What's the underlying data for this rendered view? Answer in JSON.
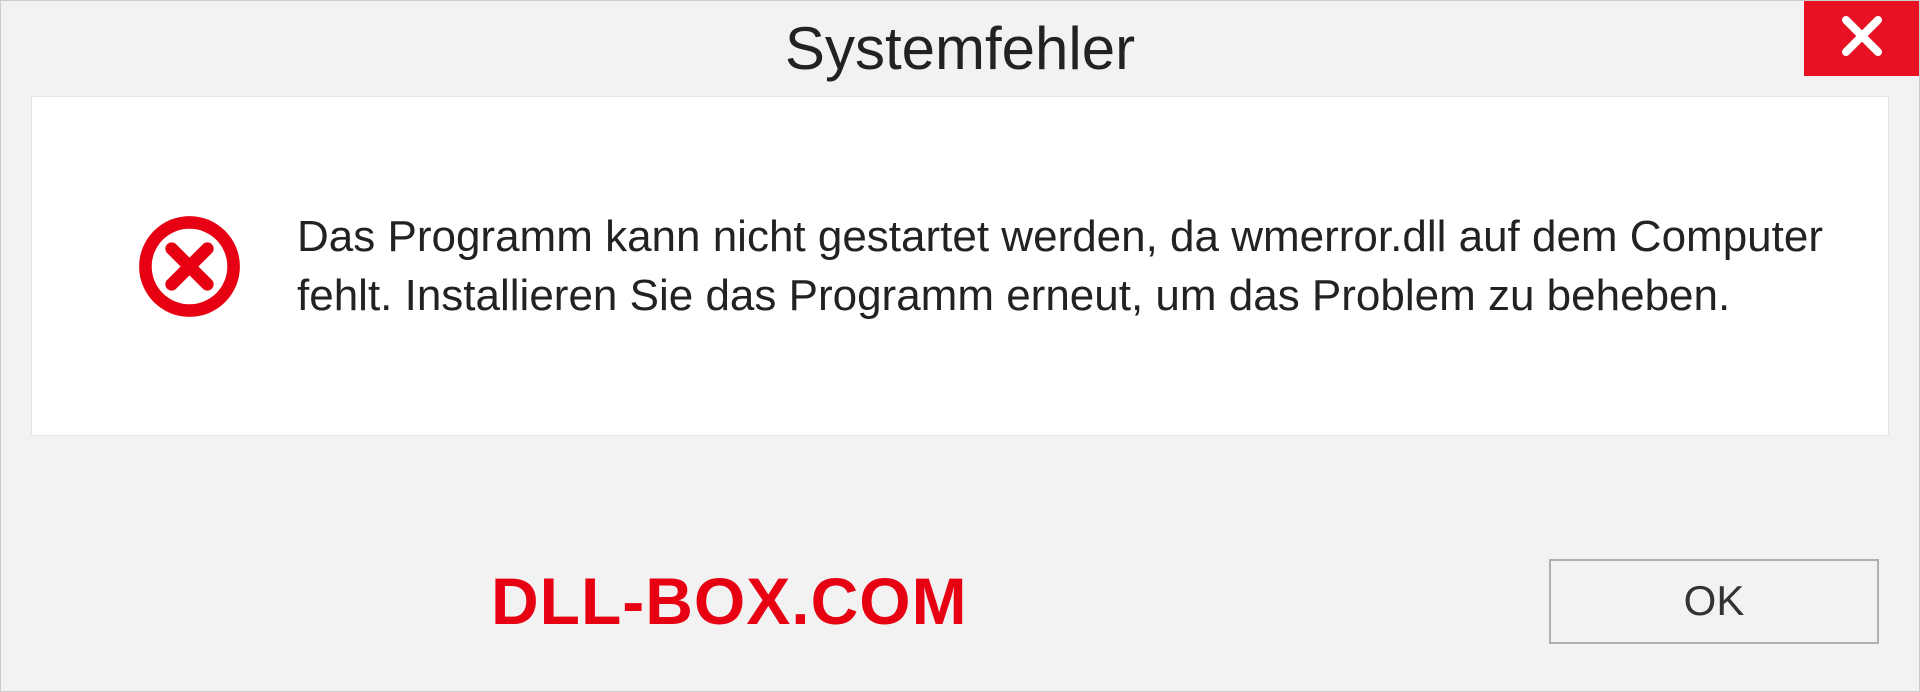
{
  "dialog": {
    "title": "Systemfehler",
    "message": "Das Programm kann nicht gestartet werden, da wmerror.dll auf dem Computer fehlt. Installieren Sie das Programm erneut, um das Problem zu beheben.",
    "ok_label": "OK"
  },
  "watermark": "DLL-BOX.COM"
}
